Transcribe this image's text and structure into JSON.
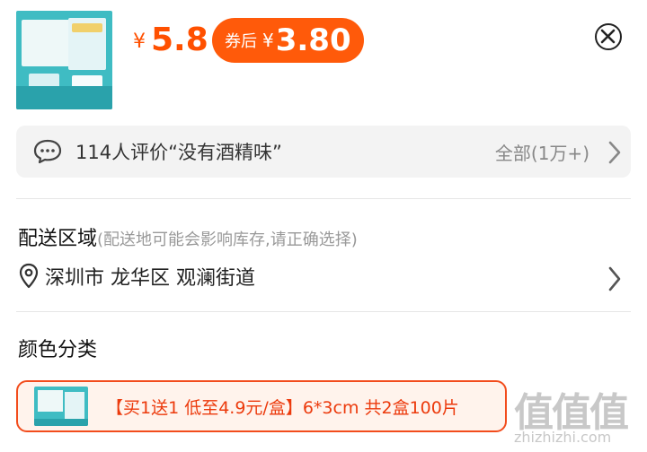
{
  "header": {
    "product_image_icon": "product-package-image",
    "price_currency": "¥",
    "price": "5.8",
    "coupon_label": "券后",
    "coupon_currency": "¥",
    "coupon_price": "3.80",
    "close_icon": "close-circle-icon"
  },
  "review": {
    "icon": "chat-bubble-icon",
    "text": "114人评价“没有酒精味”",
    "all_label": "全部(1万+)",
    "chevron": "chevron-right-icon"
  },
  "delivery": {
    "title": "配送区域",
    "note": "(配送地可能会影响库存,请正确选择)",
    "pin_icon": "location-pin-icon",
    "address": "深圳市 龙华区 观澜街道",
    "chevron": "chevron-right-icon"
  },
  "color": {
    "title": "颜色分类",
    "option_label": "【买1送1 低至4.9元/盒】6*3cm 共2盒100片",
    "option_selected": true
  },
  "watermark": {
    "logo": "值值值",
    "url": "zhizhizhi.com"
  },
  "colors": {
    "accent": "#ff5000",
    "coupon_bg": "#ff5a0a",
    "selected_border": "#f24c1c",
    "selected_bg": "#fff3ec",
    "review_bg": "#f3f3f3"
  }
}
